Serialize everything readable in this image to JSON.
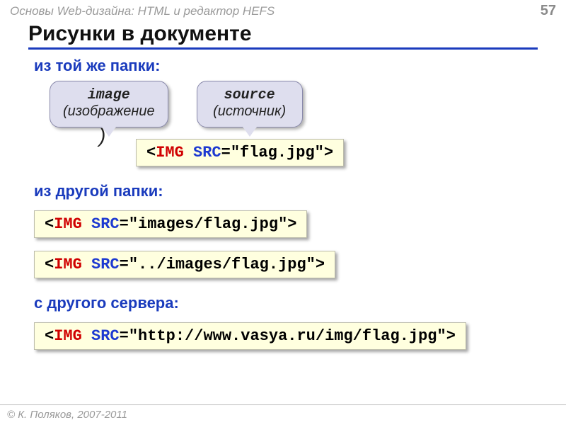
{
  "header": {
    "course": "Основы Web-дизайна: HTML и редактор HEFS",
    "page": "57"
  },
  "title": "Рисунки в документе",
  "sections": {
    "same_folder": "из той же папки:",
    "other_folder": "из другой папки:",
    "other_server": "с другого сервера:"
  },
  "callouts": {
    "image": {
      "term": "image",
      "translation": "(изображение"
    },
    "closing_paren": ")",
    "source": {
      "term": "source",
      "translation": "(источник)"
    }
  },
  "code": {
    "lt": "<",
    "gt": ">",
    "tag": "IMG",
    "attr": "SRC",
    "eq": "=",
    "v1": "\"flag.jpg\"",
    "v2": "\"images/flag.jpg\"",
    "v3": "\"../images/flag.jpg\"",
    "v4": "\"http://www.vasya.ru/img/flag.jpg\""
  },
  "footer": "© К. Поляков, 2007-2011"
}
